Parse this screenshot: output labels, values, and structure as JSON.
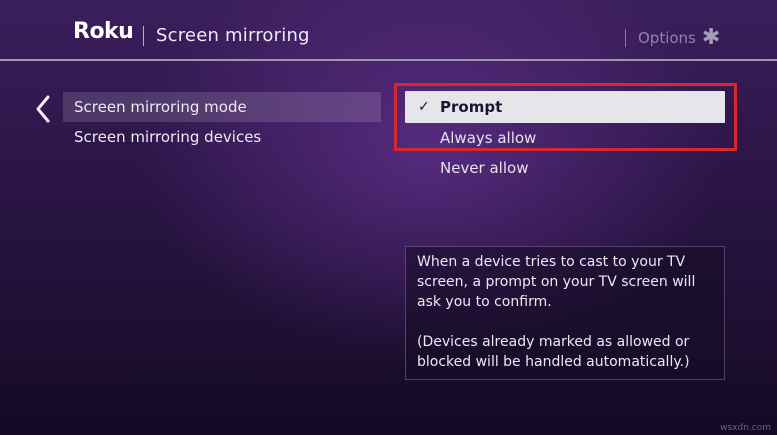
{
  "header": {
    "logo_text": "Roku",
    "title": "Screen mirroring",
    "options_label": "Options",
    "options_glyph": "✱"
  },
  "menu": {
    "items": [
      {
        "label": "Screen mirroring mode",
        "active": true
      },
      {
        "label": "Screen mirroring devices",
        "active": false
      }
    ]
  },
  "mode_options": {
    "selected_index": 0,
    "check_glyph": "✓",
    "items": [
      {
        "label": "Prompt"
      },
      {
        "label": "Always allow"
      },
      {
        "label": "Never allow"
      }
    ]
  },
  "info": {
    "paragraph_1": "When a device tries to cast to your TV screen, a prompt on your TV screen will ask you to confirm.",
    "paragraph_2": "(Devices already marked as allowed or blocked will be handled automatically.)"
  },
  "watermark": "wsxdn.com",
  "colors": {
    "highlight_border": "#d7282f",
    "selected_bg": "#e6e5e9",
    "background_top": "#3b1f5c",
    "background_bottom": "#140a24"
  }
}
